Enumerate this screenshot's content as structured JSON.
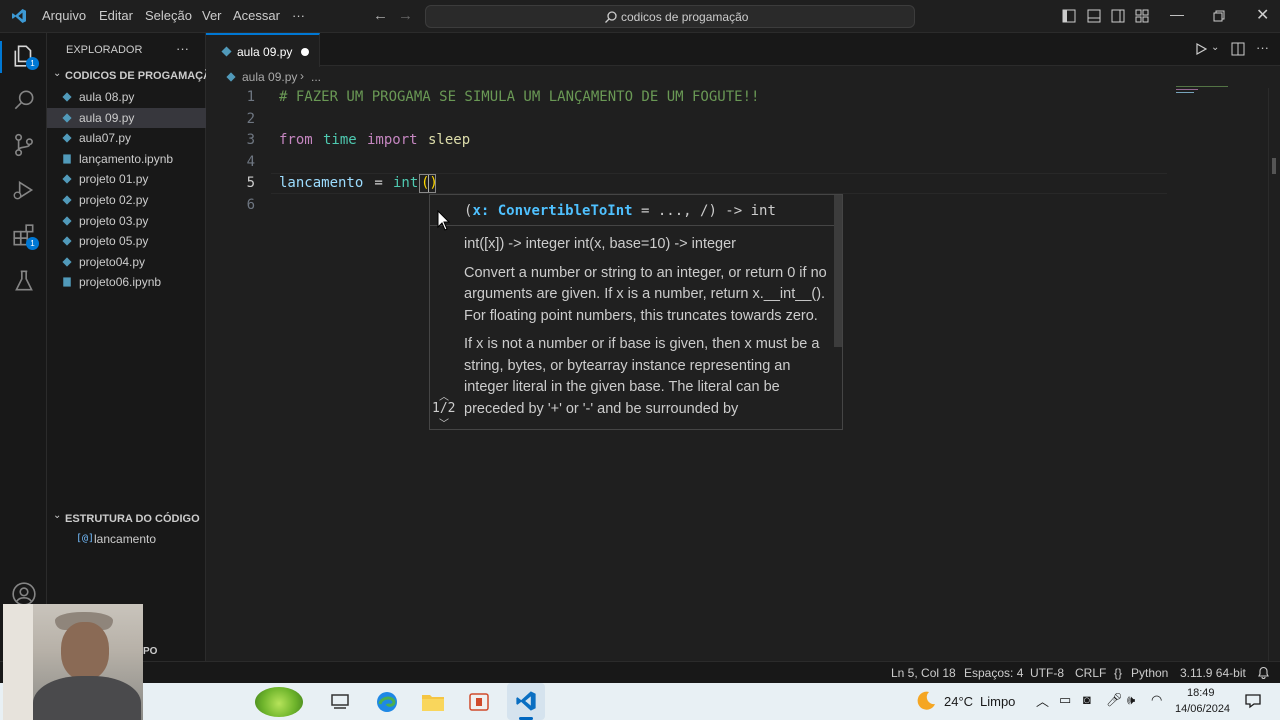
{
  "menu": [
    "Arquivo",
    "Editar",
    "Seleção",
    "Ver",
    "Acessar",
    "···"
  ],
  "search": {
    "text": "codicos de progamação"
  },
  "activity": {
    "explorer_badge": "1",
    "extensions_badge": "1"
  },
  "sidebar": {
    "title": "EXPLORADOR",
    "more": "···",
    "folder": "CODICOS DE PROGAMAÇÃO",
    "files": [
      {
        "name": "aula 08.py",
        "type": "py"
      },
      {
        "name": "aula 09.py",
        "type": "py"
      },
      {
        "name": "aula07.py",
        "type": "py"
      },
      {
        "name": "lançamento.ipynb",
        "type": "nb"
      },
      {
        "name": "projeto 01.py",
        "type": "py"
      },
      {
        "name": "projeto 02.py",
        "type": "py"
      },
      {
        "name": "projeto 03.py",
        "type": "py"
      },
      {
        "name": "projeto 05.py",
        "type": "py"
      },
      {
        "name": "projeto04.py",
        "type": "py"
      },
      {
        "name": "projeto06.ipynb",
        "type": "nb"
      }
    ],
    "outline_title": "ESTRUTURA DO CÓDIGO",
    "outline_item": "lancamento",
    "timeline_partial": "PO"
  },
  "tab": {
    "label": "aula 09.py"
  },
  "breadcrumb": {
    "file": "aula 09.py",
    "rest": "..."
  },
  "code": {
    "line1": "# FAZER UM PROGAMA SE SIMULA UM LANÇAMENTO DE UM FOGUTE!!",
    "line3": {
      "kw": "from",
      "mod": "time",
      "kw2": "import",
      "name": "sleep"
    },
    "line5": {
      "var": "lancamento",
      "op": " = ",
      "fn": "int"
    },
    "line_numbers": [
      "1",
      "2",
      "3",
      "4",
      "5",
      "6"
    ]
  },
  "hover": {
    "sig_open": "(",
    "sig_param": "x: ConvertibleToInt",
    "sig_rest": " = ..., /) -> int",
    "doc1": "int([x]) -> integer int(x, base=10) -> integer",
    "doc2": "Convert a number or string to an integer, or return 0 if no arguments are given. If x is a number, return x.__int__(). For floating point numbers, this truncates towards zero.",
    "doc3": "If x is not a number or if base is given, then x must be a string, bytes, or bytearray instance representing an integer literal in the given base. The literal can be preceded by '+' or '-' and be surrounded by",
    "counter": "1/2"
  },
  "status": {
    "position": "Ln 5, Col 18",
    "spaces": "Espaços: 4",
    "encoding": "UTF-8",
    "eol": "CRLF",
    "language": "Python",
    "interpreter": "3.11.9 64-bit"
  },
  "taskbar": {
    "weather_temp": "24°C",
    "weather_text": "Limpo",
    "time": "18:49",
    "date": "14/06/2024"
  },
  "colors": {
    "accent": "#0078d4",
    "comment": "#6a9955",
    "keyword": "#c586c0",
    "variable": "#9cdcfe",
    "function": "#4ec9b0",
    "param": "#4fc1ff"
  }
}
